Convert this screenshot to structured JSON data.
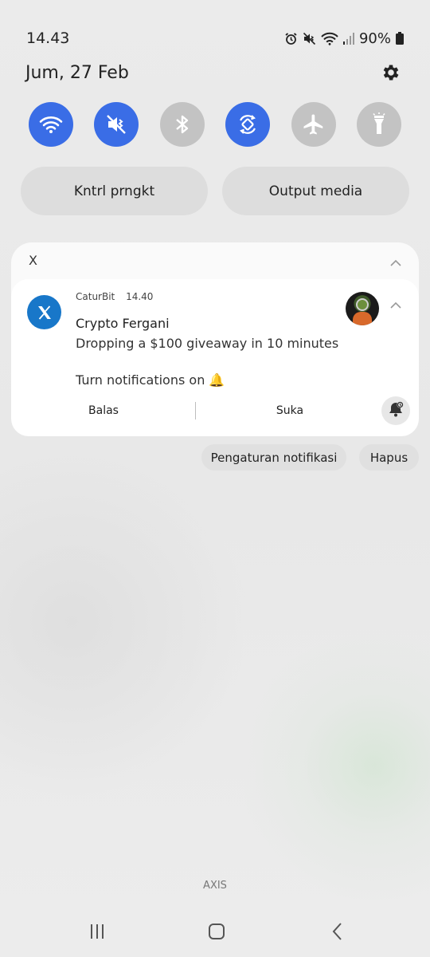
{
  "status_bar": {
    "time": "14.43",
    "battery_percent": "90%",
    "icons": [
      "alarm-icon",
      "mute-icon",
      "wifi-icon",
      "signal-icon",
      "battery-icon"
    ]
  },
  "header": {
    "date": "Jum, 27 Feb",
    "settings_icon": "gear-icon"
  },
  "quick_toggles": [
    {
      "name": "wifi",
      "icon": "wifi-icon",
      "state": "on"
    },
    {
      "name": "mute",
      "icon": "mute-icon",
      "state": "on"
    },
    {
      "name": "bluetooth",
      "icon": "bluetooth-icon",
      "state": "off"
    },
    {
      "name": "auto-rotate",
      "icon": "auto-rotate-icon",
      "state": "on"
    },
    {
      "name": "airplane-mode",
      "icon": "airplane-icon",
      "state": "off"
    },
    {
      "name": "flashlight",
      "icon": "flashlight-icon",
      "state": "off"
    }
  ],
  "pills": {
    "device_control": "Kntrl prngkt",
    "media_output": "Output media"
  },
  "notification_group": {
    "app_name": "X",
    "notification": {
      "sender": "CaturBit",
      "time": "14.40",
      "title": "Crypto Fergani",
      "body": "Dropping a $100 giveaway in 10 minutes\n\nTurn notifications on 🔔",
      "actions": {
        "reply": "Balas",
        "like": "Suka"
      }
    }
  },
  "bottom_actions": {
    "notification_settings": "Pengaturan notifikasi",
    "clear": "Hapus"
  },
  "carrier": "AXIS",
  "colors": {
    "accent": "#3a6de6",
    "toggle_off": "#c3c3c3",
    "x_brand": "#1877c9"
  }
}
